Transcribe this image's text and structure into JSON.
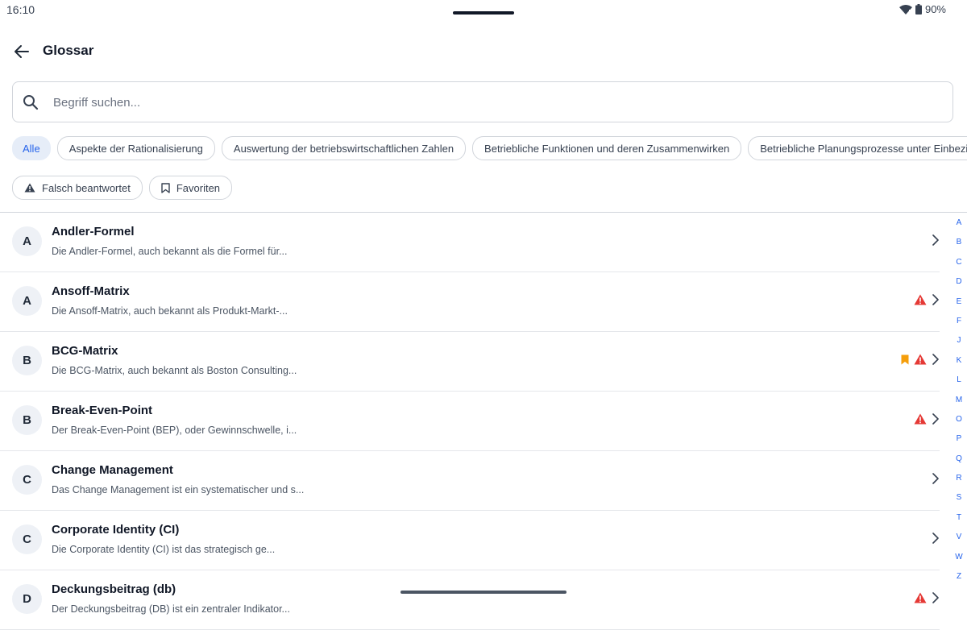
{
  "status_bar": {
    "time": "16:10",
    "battery": "90%"
  },
  "header": {
    "title": "Glossar"
  },
  "search": {
    "placeholder": "Begriff suchen..."
  },
  "filters": {
    "chips": [
      {
        "label": "Alle",
        "active": true
      },
      {
        "label": "Aspekte der Rationalisierung"
      },
      {
        "label": "Auswertung der betriebswirtschaftlichen Zahlen"
      },
      {
        "label": "Betriebliche Funktionen und deren Zusammenwirken"
      },
      {
        "label": "Betriebliche Planungsprozesse unter Einbeziehung"
      }
    ],
    "wrong_label": "Falsch beantwortet",
    "favorites_label": "Favoriten"
  },
  "items": [
    {
      "letter": "A",
      "title": "Andler-Formel",
      "desc": "Die Andler-Formel, auch bekannt als die Formel für..."
    },
    {
      "letter": "A",
      "title": "Ansoff-Matrix",
      "desc": "Die Ansoff-Matrix, auch bekannt als Produkt-Markt-..."
    },
    {
      "letter": "B",
      "title": "BCG-Matrix",
      "desc": "Die BCG-Matrix, auch bekannt als Boston Consulting..."
    },
    {
      "letter": "B",
      "title": "Break-Even-Point",
      "desc": "Der Break-Even-Point (BEP), oder Gewinnschwelle, i..."
    },
    {
      "letter": "C",
      "title": "Change Management",
      "desc": "Das Change Management ist ein systematischer und s..."
    },
    {
      "letter": "C",
      "title": "Corporate Identity (CI)",
      "desc": "Die Corporate Identity (CI) ist das strategisch ge..."
    },
    {
      "letter": "D",
      "title": "Deckungsbeitrag (db)",
      "desc": "Der Deckungsbeitrag (DB) ist ein zentraler Indikator..."
    }
  ],
  "alphabet": [
    "A",
    "B",
    "C",
    "D",
    "E",
    "F",
    "J",
    "K",
    "L",
    "M",
    "O",
    "P",
    "Q",
    "R",
    "S",
    "T",
    "V",
    "W",
    "Z"
  ],
  "colors": {
    "accent": "#2563eb",
    "warning": "#e53935",
    "bookmark": "#f59e0b"
  },
  "icons": {
    "wrong": "warning-icon",
    "favorite": "bookmark-icon",
    "open": "chevron-right-icon"
  }
}
